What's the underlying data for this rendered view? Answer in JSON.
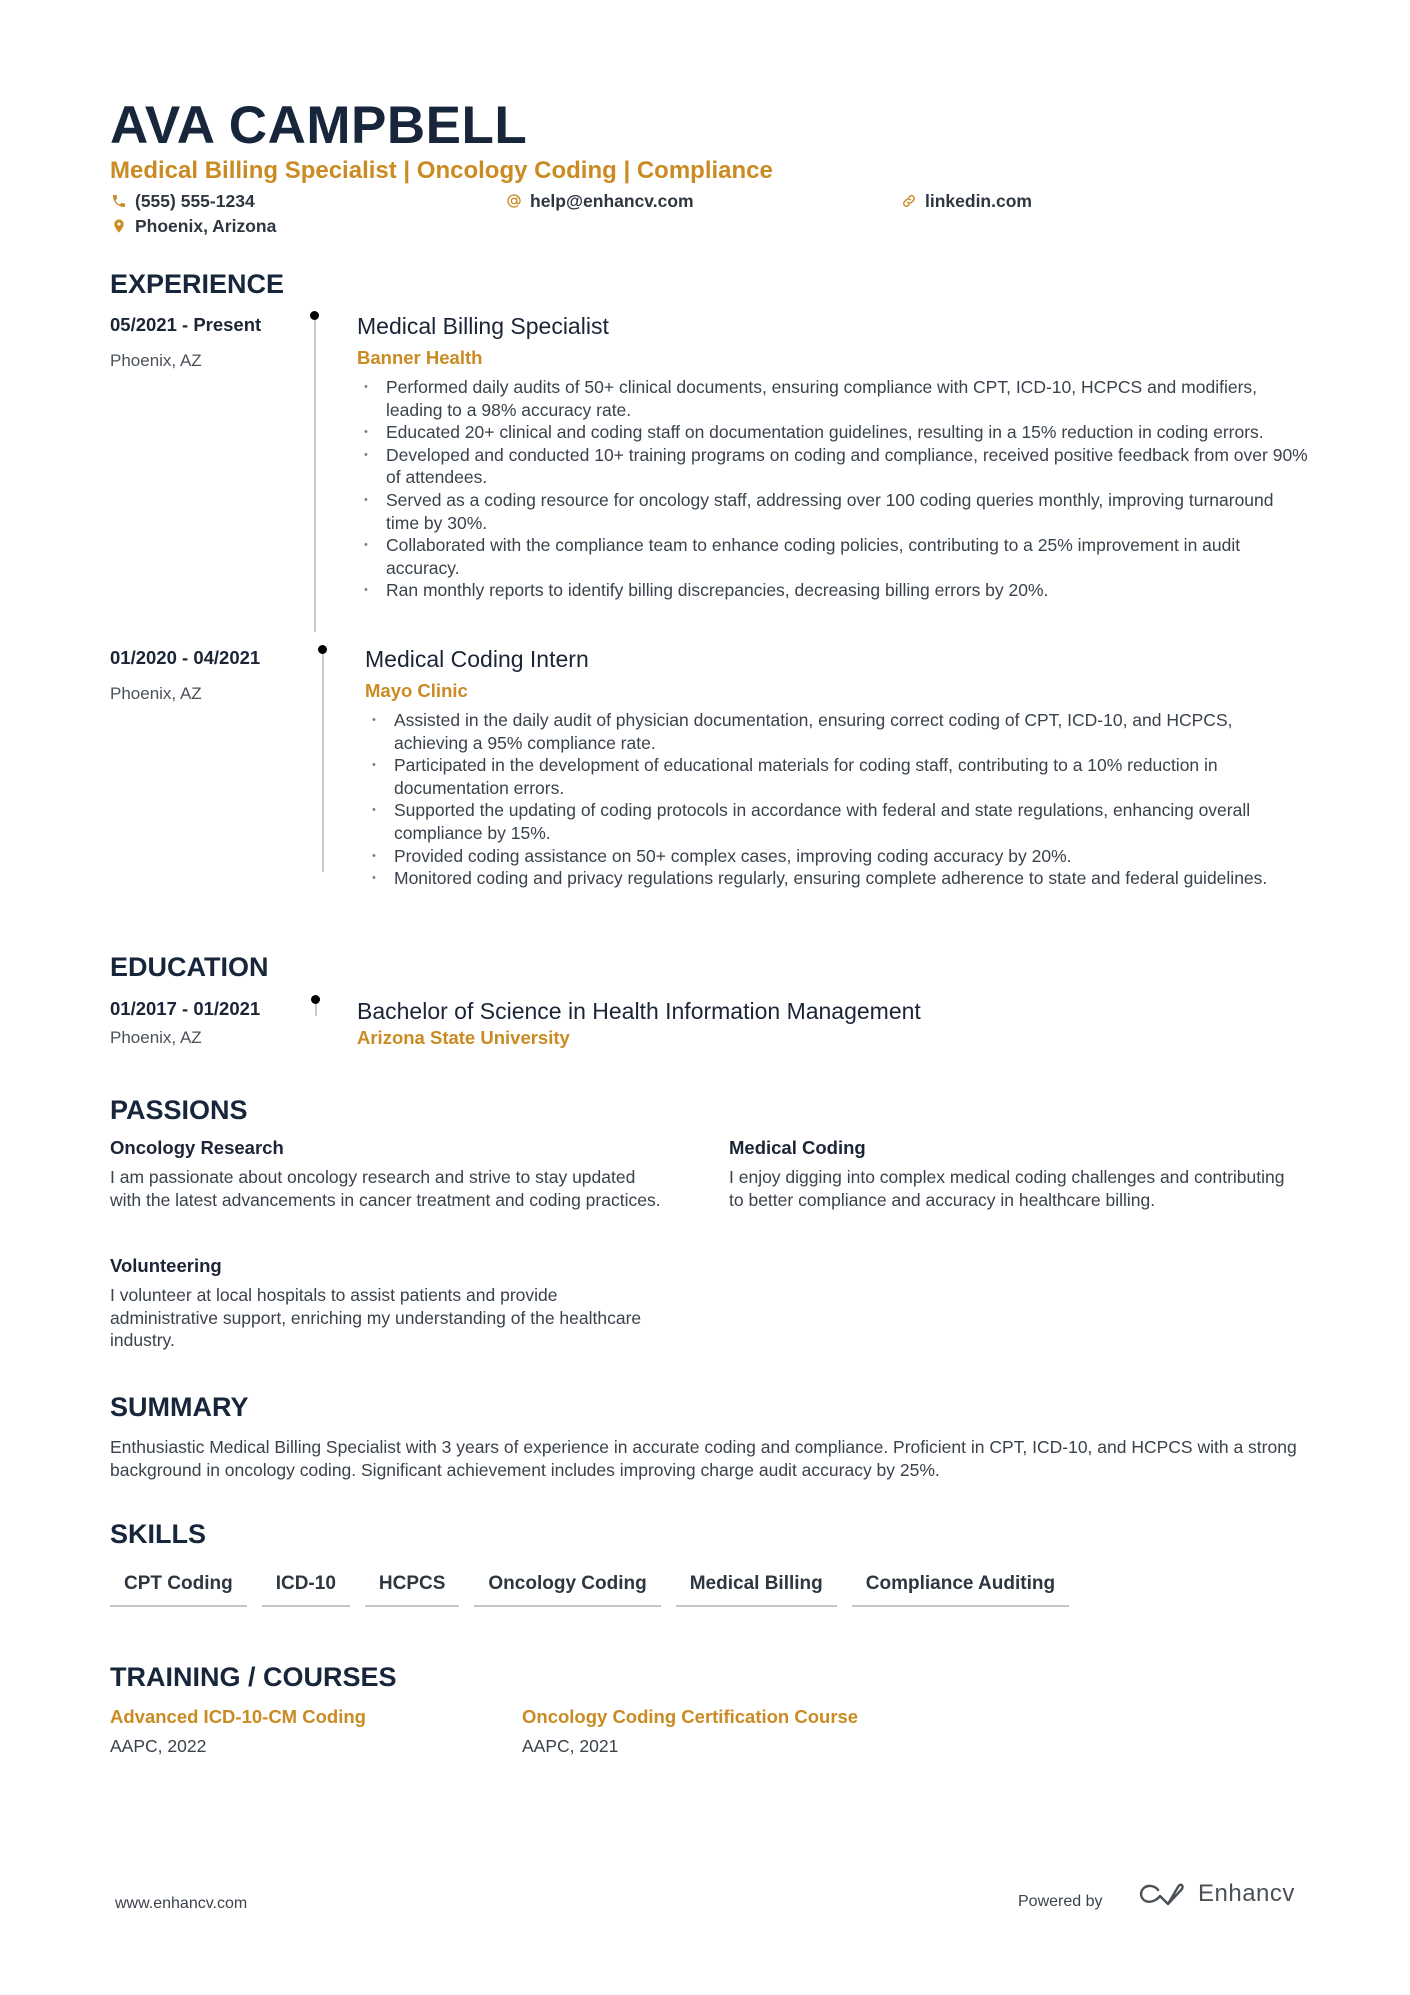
{
  "header": {
    "name": "AVA CAMPBELL",
    "headline": "Medical Billing Specialist | Oncology Coding | Compliance",
    "phone": "(555) 555-1234",
    "email": "help@enhancv.com",
    "linkedin": "linkedin.com",
    "location": "Phoenix, Arizona",
    "icons": {
      "phone": "phone-icon",
      "email": "at-icon",
      "linkedin": "link-icon",
      "location": "map-pin-icon"
    },
    "accent_color": "#c98b22"
  },
  "experience": {
    "title": "EXPERIENCE",
    "items": [
      {
        "dates": "05/2021 - Present",
        "location": "Phoenix, AZ",
        "role": "Medical Billing Specialist",
        "company": "Banner Health",
        "bullets": [
          "Performed daily audits of 50+ clinical documents, ensuring compliance with CPT, ICD-10, HCPCS and modifiers, leading to a 98% accuracy rate.",
          "Educated 20+ clinical and coding staff on documentation guidelines, resulting in a 15% reduction in coding errors.",
          "Developed and conducted 10+ training programs on coding and compliance, received positive feedback from over 90% of attendees.",
          "Served as a coding resource for oncology staff, addressing over 100 coding queries monthly, improving turnaround time by 30%.",
          "Collaborated with the compliance team to enhance coding policies, contributing to a 25% improvement in audit accuracy.",
          "Ran monthly reports to identify billing discrepancies, decreasing billing errors by 20%."
        ]
      },
      {
        "dates": "01/2020 - 04/2021",
        "location": "Phoenix, AZ",
        "role": "Medical Coding Intern",
        "company": "Mayo Clinic",
        "bullets": [
          "Assisted in the daily audit of physician documentation, ensuring correct coding of CPT, ICD-10, and HCPCS, achieving a 95% compliance rate.",
          "Participated in the development of educational materials for coding staff, contributing to a 10% reduction in documentation errors.",
          "Supported the updating of coding protocols in accordance with federal and state regulations, enhancing overall compliance by 15%.",
          "Provided coding assistance on 50+ complex cases, improving coding accuracy by 20%.",
          "Monitored coding and privacy regulations regularly, ensuring complete adherence to state and federal guidelines."
        ]
      }
    ]
  },
  "education": {
    "title": "EDUCATION",
    "items": [
      {
        "dates": "01/2017 - 01/2021",
        "location": "Phoenix, AZ",
        "degree": "Bachelor of Science in Health Information Management",
        "school": "Arizona State University"
      }
    ]
  },
  "passions": {
    "title": "PASSIONS",
    "items": [
      {
        "title": "Oncology Research",
        "description": "I am passionate about oncology research and strive to stay updated with the latest advancements in cancer treatment and coding practices."
      },
      {
        "title": "Medical Coding",
        "description": "I enjoy digging into complex medical coding challenges and contributing to better compliance and accuracy in healthcare billing."
      },
      {
        "title": "Volunteering",
        "description": "I volunteer at local hospitals to assist patients and provide administrative support, enriching my understanding of the healthcare industry."
      }
    ]
  },
  "summary": {
    "title": "SUMMARY",
    "text": "Enthusiastic Medical Billing Specialist with 3 years of experience in accurate coding and compliance. Proficient in CPT, ICD-10, and HCPCS with a strong background in oncology coding. Significant achievement includes improving charge audit accuracy by 25%."
  },
  "skills": {
    "title": "SKILLS",
    "items": [
      "CPT Coding",
      "ICD-10",
      "HCPCS",
      "Oncology Coding",
      "Medical Billing",
      "Compliance Auditing"
    ]
  },
  "training": {
    "title": "TRAINING / COURSES",
    "items": [
      {
        "title": "Advanced ICD-10-CM Coding",
        "subtitle": "AAPC, 2022"
      },
      {
        "title": "Oncology Coding Certification Course",
        "subtitle": "AAPC, 2021"
      }
    ]
  },
  "footer": {
    "url": "www.enhancv.com",
    "powered_by": "Powered by",
    "brand": "Enhancv"
  }
}
